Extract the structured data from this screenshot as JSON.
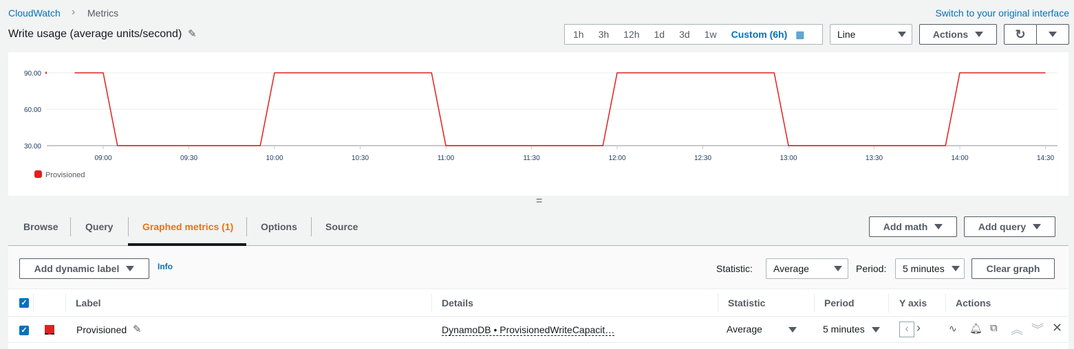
{
  "breadcrumb": {
    "root": "CloudWatch",
    "current": "Metrics"
  },
  "switch_link": "Switch to your original interface",
  "title": "Write usage (average units/second)",
  "time_ranges": [
    "1h",
    "3h",
    "12h",
    "1d",
    "3d",
    "1w"
  ],
  "custom_range": "Custom (6h)",
  "chart_type": "Line",
  "actions_label": "Actions",
  "colors": {
    "series": "#e02020",
    "accent": "#0073bb",
    "active_tab": "#ec7211"
  },
  "chart_data": {
    "type": "line",
    "ylim": [
      30,
      90
    ],
    "yticks": [
      "90.00",
      "60.00",
      "30.00"
    ],
    "ytick_values": [
      90,
      60,
      30
    ],
    "xticks": [
      "09:00",
      "09:30",
      "10:00",
      "10:30",
      "11:00",
      "11:30",
      "12:00",
      "12:30",
      "13:00",
      "13:30",
      "14:00",
      "14:30"
    ],
    "series": [
      {
        "name": "Provisioned",
        "color": "#e02020",
        "x_minutes_from_0900": [
          -20,
          -10,
          0,
          5,
          55,
          60,
          115,
          120,
          175,
          180,
          235,
          240,
          295,
          300,
          330
        ],
        "values": [
          90,
          90,
          90,
          30,
          30,
          90,
          90,
          30,
          30,
          90,
          90,
          30,
          30,
          90,
          90
        ]
      }
    ],
    "legend": "bottom-left"
  },
  "tabs": [
    "Browse",
    "Query",
    "Graphed metrics (1)",
    "Options",
    "Source"
  ],
  "add_math": "Add math",
  "add_query": "Add query",
  "add_dynamic_label": "Add dynamic label",
  "info": "Info",
  "statistic_label": "Statistic:",
  "statistic_value": "Average",
  "period_label": "Period:",
  "period_value": "5 minutes",
  "clear_graph": "Clear graph",
  "columns": [
    "Label",
    "Details",
    "Statistic",
    "Period",
    "Y axis",
    "Actions"
  ],
  "row": {
    "label": "Provisioned",
    "details": "DynamoDB • ProvisionedWriteCapacit…",
    "statistic": "Average",
    "period": "5 minutes"
  }
}
